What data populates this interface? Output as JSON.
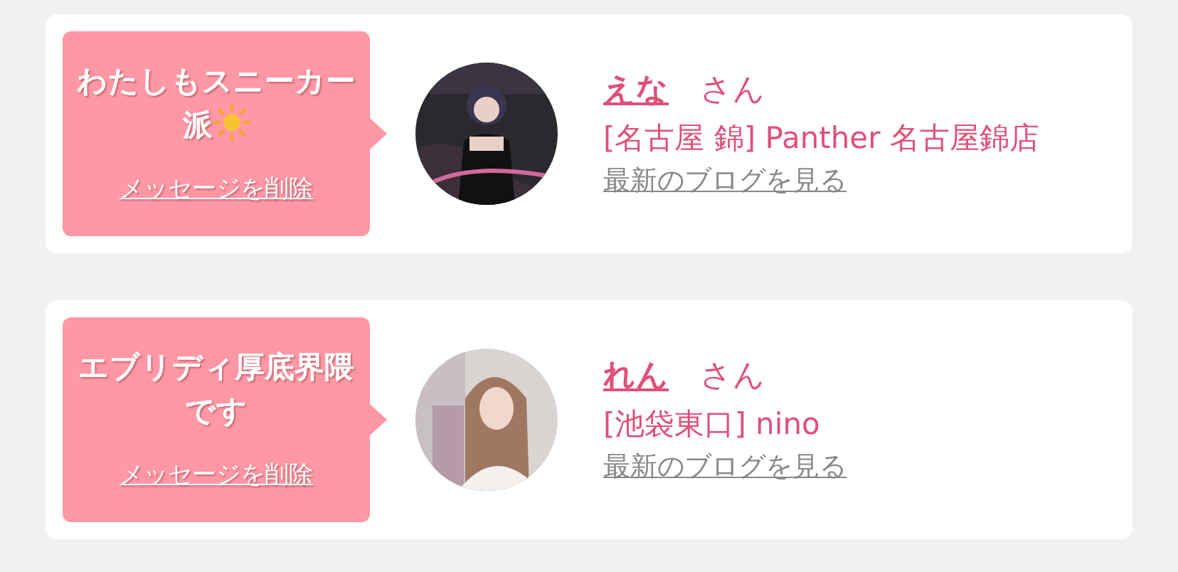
{
  "messages": [
    {
      "kind": "with_icon",
      "message": "わたしもスニーカー派",
      "delete_link": "メッセージを削除",
      "name": "えな",
      "honorific": "さん",
      "shop": "[名古屋 錦] Panther 名古屋錦店",
      "blog_link": "最新のブログを見る"
    },
    {
      "kind": "plain",
      "message": "エブリディ厚底界隈です",
      "delete_link": "メッセージを削除",
      "name": "れん",
      "honorific": "さん",
      "shop": "[池袋東口] nino",
      "blog_link": "最新のブログを見る"
    }
  ]
}
